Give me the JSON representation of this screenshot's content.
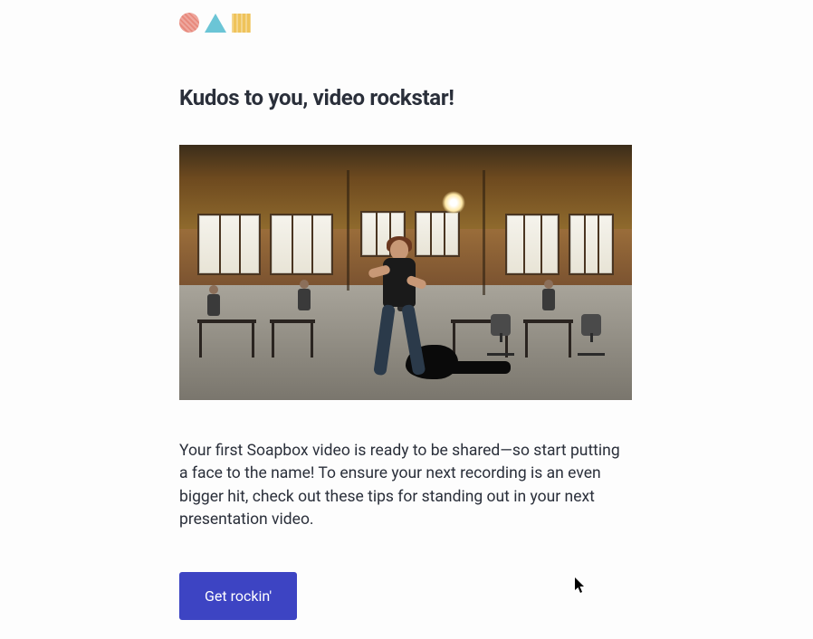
{
  "logo": {
    "shapes": [
      "circle-icon",
      "triangle-icon",
      "square-icon"
    ]
  },
  "headline": "Kudos to you, video rockstar!",
  "hero": {
    "alt": "Person playing air guitar in an open loft-style office with exposed brick, large industrial windows, desks, and a black guitar case on the floor"
  },
  "body_text": "Your first Soapbox video is ready to be shared—so start putting a face to the name! To ensure your next recording is an even bigger hit, check out these tips for standing out in your next presentation video.",
  "cta": {
    "label": "Get rockin'"
  }
}
